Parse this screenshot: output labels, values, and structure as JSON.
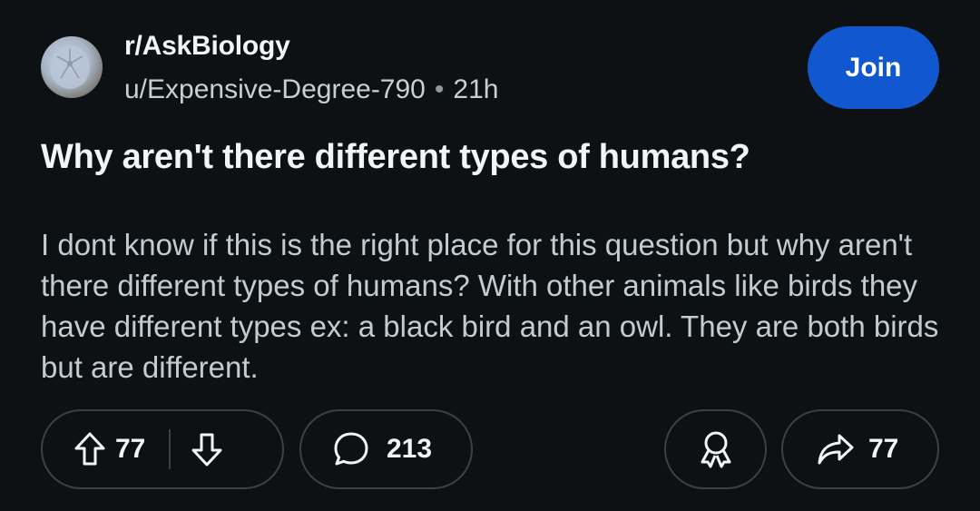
{
  "post": {
    "subreddit": "r/AskBiology",
    "author": "u/Expensive-Degree-790",
    "separator": "•",
    "age": "21h",
    "title": "Why aren't there different types of humans?",
    "body": "I dont know if this is the right place for this question but why aren't there different types of humans? With other animals like birds they have different types ex: a black bird and an owl. They are both birds but are different."
  },
  "join": {
    "label": "Join",
    "color": "#1157cf"
  },
  "actions": {
    "upvotes": "77",
    "comments": "213",
    "shares": "77"
  },
  "icons": {
    "upvote": "upvote-arrow-icon",
    "downvote": "downvote-arrow-icon",
    "comment": "comment-bubble-icon",
    "award": "award-ribbon-icon",
    "share": "share-arrow-icon"
  },
  "colors": {
    "background": "#0e1113",
    "pill_border": "#3b4246",
    "body_text": "#c3ccd1"
  }
}
